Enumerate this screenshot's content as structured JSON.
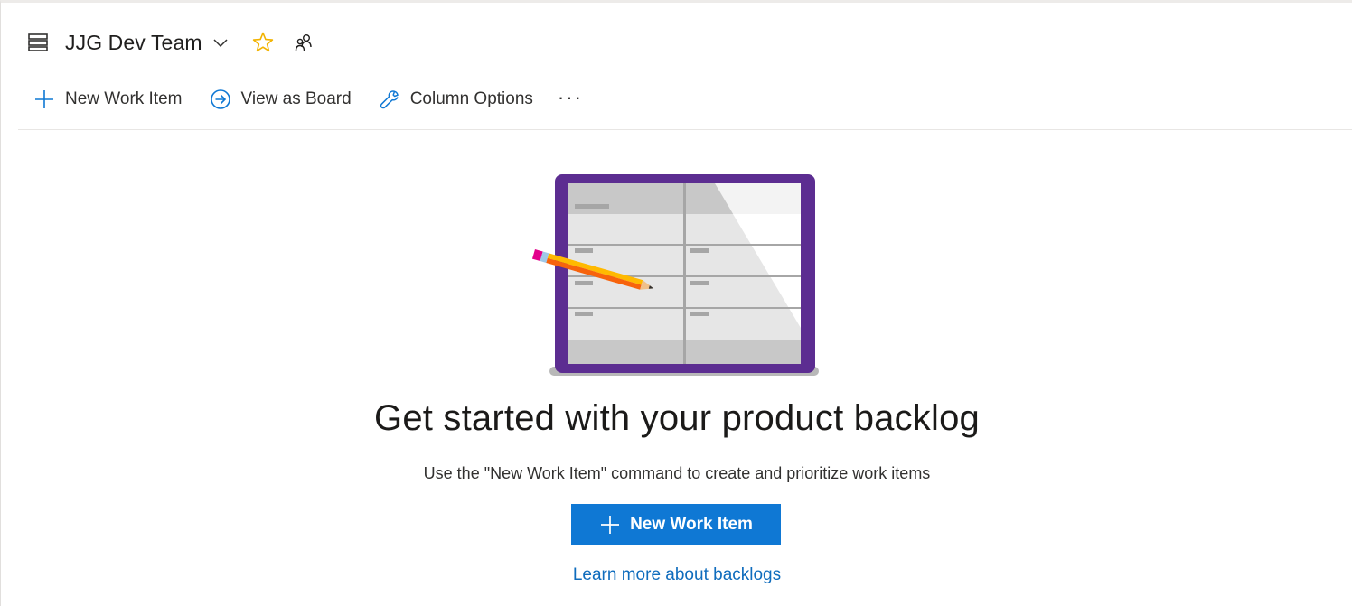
{
  "header": {
    "team_name": "JJG Dev Team",
    "icons": [
      "backlog-icon",
      "chevron-down-icon",
      "star-icon",
      "team-members-icon"
    ],
    "star_color": "#f2b300"
  },
  "toolbar": {
    "new_work_item": "New Work Item",
    "view_as_board": "View as Board",
    "column_options": "Column Options",
    "more": "···",
    "accent": "#0f78d4"
  },
  "empty_state": {
    "title": "Get started with your product backlog",
    "description": "Use the \"New Work Item\" command to create and prioritize work items",
    "button_label": "New Work Item",
    "button_color": "#0f78d4",
    "link_text": "Learn more about backlogs",
    "illustration": "backlog-board-with-pencil-illustration"
  }
}
